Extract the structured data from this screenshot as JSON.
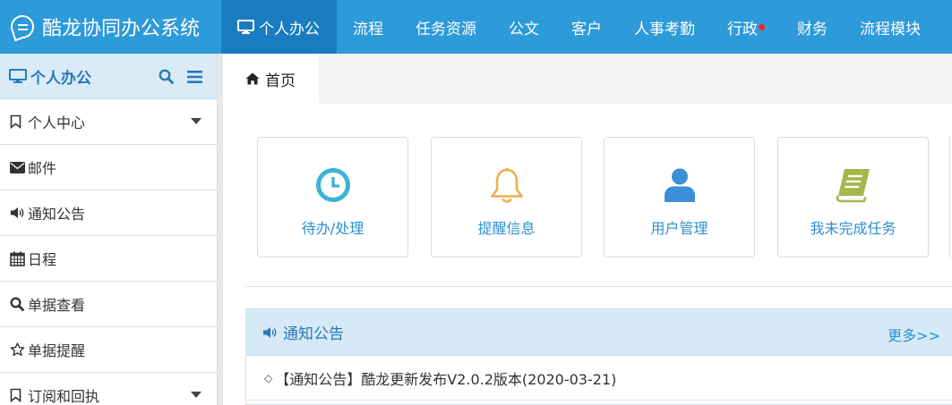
{
  "app": {
    "title": "酷龙协同办公系统"
  },
  "nav": {
    "items": [
      {
        "label": "个人办公",
        "active": true
      },
      {
        "label": "流程"
      },
      {
        "label": "任务资源"
      },
      {
        "label": "公文"
      },
      {
        "label": "客户"
      },
      {
        "label": "人事考勤"
      },
      {
        "label": "行政",
        "has_dot": true
      },
      {
        "label": "财务"
      },
      {
        "label": "流程模块"
      }
    ]
  },
  "sidebar": {
    "header": {
      "label": "个人办公",
      "icon": "monitor-icon"
    },
    "items": [
      {
        "label": "个人中心",
        "icon": "bookmark-icon",
        "has_caret": true
      },
      {
        "label": "邮件",
        "icon": "envelope-icon"
      },
      {
        "label": "通知公告",
        "icon": "volume-icon"
      },
      {
        "label": "日程",
        "icon": "calendar-icon"
      },
      {
        "label": "单据查看",
        "icon": "search-icon"
      },
      {
        "label": "单据提醒",
        "icon": "star-icon"
      },
      {
        "label": "订阅和回执",
        "icon": "bookmark-icon",
        "has_caret": true
      }
    ]
  },
  "tabs": {
    "home": {
      "label": "首页",
      "icon": "home-icon"
    }
  },
  "cards": [
    {
      "label": "待办/处理",
      "icon": "clock-icon",
      "color": "#3bb4d8"
    },
    {
      "label": "提醒信息",
      "icon": "bell-icon",
      "color": "#f0ad4e"
    },
    {
      "label": "用户管理",
      "icon": "user-icon",
      "color": "#3a8fd6"
    },
    {
      "label": "我未完成任务",
      "icon": "book-icon",
      "color": "#a4b84e"
    }
  ],
  "notice": {
    "title": "通知公告",
    "more": "更多>>",
    "items": [
      "【通知公告】酷龙更新发布V2.0.2版本(2020-03-21)"
    ]
  },
  "colors": {
    "topbar": "#2d9ad9",
    "nav_active": "#1a7cc0",
    "accent_text": "#2d8fd0",
    "panel_header": "#d5eaf6"
  }
}
